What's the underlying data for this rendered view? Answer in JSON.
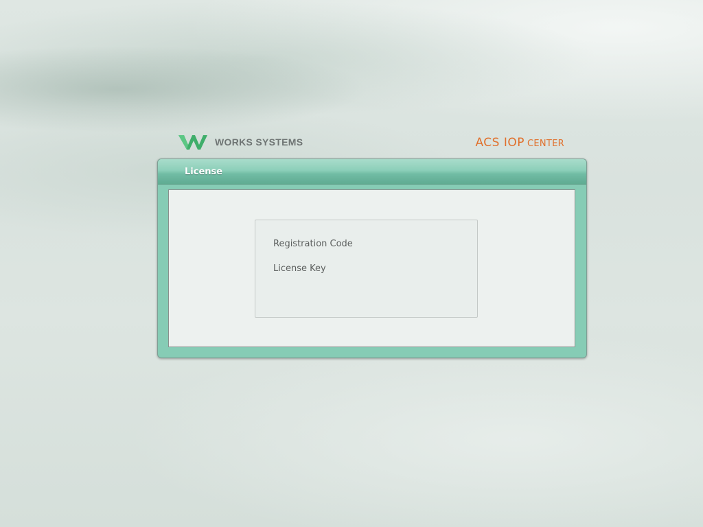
{
  "header": {
    "left_logo_text": "WORKS SYSTEMS",
    "right_logo_big": "ACS IOP",
    "right_logo_small": "CENTER"
  },
  "panel": {
    "title": "License",
    "fields": {
      "registration_code_label": "Registration Code",
      "license_key_label": "License Key"
    }
  },
  "colors": {
    "brand_green": "#3fae6a",
    "brand_orange": "#e0702c",
    "panel_teal": "#86ccb5"
  },
  "icons": {
    "left_logo": "works-systems-w-logo"
  }
}
